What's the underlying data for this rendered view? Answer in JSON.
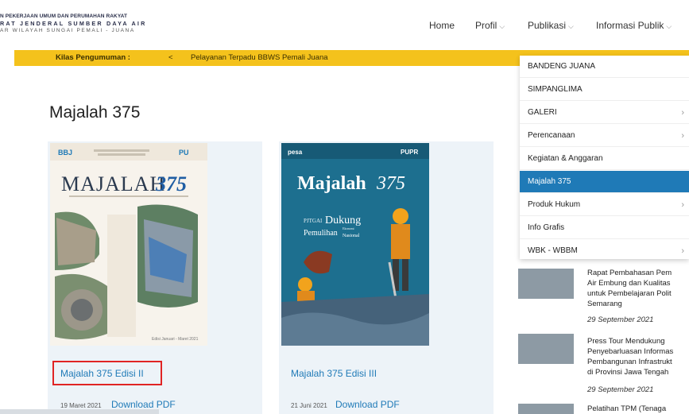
{
  "header": {
    "org_line1": "N PEKERJAAN UMUM DAN PERUMAHAN RAKYAT",
    "org_line2": "RAT JENDERAL SUMBER DAYA AIR",
    "org_line3": "AR WILAYAH SUNGAI PEMALI - JUANA"
  },
  "nav": {
    "home": "Home",
    "profil": "Profil",
    "publikasi": "Publikasi",
    "informasi_publik": "Informasi Publik",
    "chevron": "⌵"
  },
  "ticker": {
    "label": "Kilas Pengumuman :",
    "arrow": "<",
    "text": "Pelayanan Terpadu BBWS Pemali Juana"
  },
  "page": {
    "title": "Majalah 375"
  },
  "cards": [
    {
      "title": "Majalah 375 Edisi II",
      "date": "19 Maret 2021",
      "download": "Download PDF",
      "cover": {
        "brand_left": "BBJ",
        "brand_right": "PU",
        "title": "MAJALAH",
        "number": "375",
        "edition_text": "Edisi Januari - Maret 2021"
      }
    },
    {
      "title": "Majalah 375 Edisi III",
      "date": "21 Juni 2021",
      "download": "Download PDF",
      "cover": {
        "brand_left": "pesa",
        "brand_right": "PUPR",
        "title": "Majalah",
        "number": "375",
        "headline_small": "PJTGAI",
        "headline_big": "Dukung",
        "headline_2": "Pemulihan",
        "headline_3": "Nasional",
        "headline_note": "Ekonomi"
      }
    }
  ],
  "dropdown": {
    "items": [
      {
        "label": "BANDENG JUANA",
        "arrow": "",
        "active": false
      },
      {
        "label": "SIMPANGLIMA",
        "arrow": "",
        "active": false
      },
      {
        "label": "GALERI",
        "arrow": "›",
        "active": false
      },
      {
        "label": "Perencanaan",
        "arrow": "›",
        "active": false
      },
      {
        "label": "Kegiatan & Anggaran",
        "arrow": "",
        "active": false
      },
      {
        "label": "Majalah 375",
        "arrow": "",
        "active": true
      },
      {
        "label": "Produk Hukum",
        "arrow": "›",
        "active": false
      },
      {
        "label": "Info Grafis",
        "arrow": "",
        "active": false
      },
      {
        "label": "WBK - WBBM",
        "arrow": "›",
        "active": false
      }
    ]
  },
  "news": [
    {
      "lines": [
        "Rapat Pembahasan Pem",
        "Air Embung dan Kualitas",
        "untuk Pembelajaran Polit",
        "Semarang"
      ],
      "date": "29 September 2021"
    },
    {
      "lines": [
        "Press Tour Mendukung",
        "Penyebarluasan Informas",
        "Pembangunan Infrastrukt",
        "di Provinsi Jawa Tengah"
      ],
      "date": "29 September 2021"
    },
    {
      "lines": [
        "Pelatihan TPM (Tenaga"
      ],
      "date": ""
    }
  ],
  "colors": {
    "accent": "#1f7ab7",
    "ticker": "#f4c21c",
    "highlight": "#e02424"
  }
}
